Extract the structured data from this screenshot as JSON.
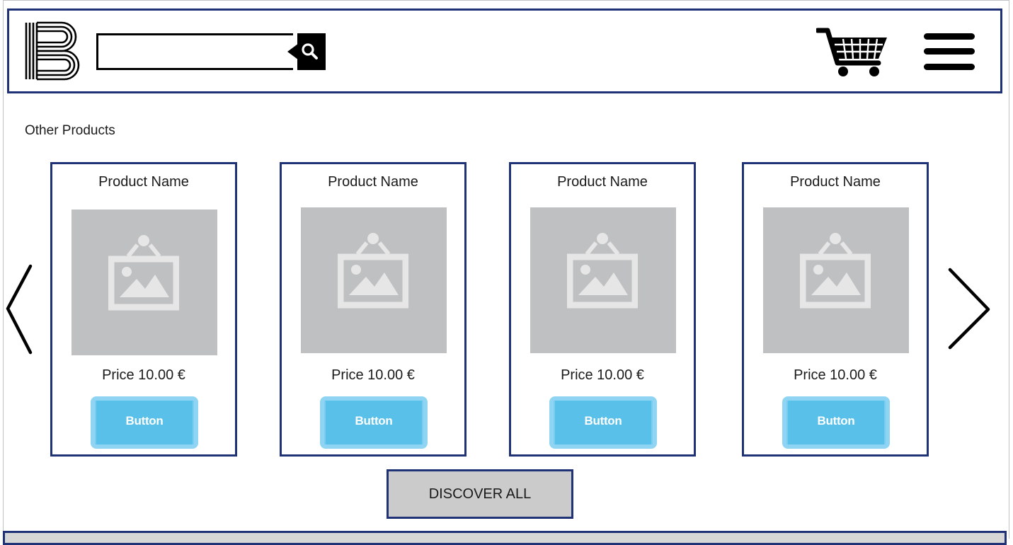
{
  "header": {
    "logo_icon": "brand-b-logo-icon",
    "search": {
      "value": "",
      "placeholder": "",
      "icon": "search-icon"
    },
    "cart_icon": "shopping-cart-icon",
    "menu_icon": "hamburger-menu-icon"
  },
  "section": {
    "title": "Other Products"
  },
  "carousel": {
    "prev_icon": "chevron-left-icon",
    "next_icon": "chevron-right-icon",
    "products": [
      {
        "name": "Product Name",
        "image_icon": "image-placeholder-icon",
        "price": "Price 10.00 €",
        "button": "Button"
      },
      {
        "name": "Product Name",
        "image_icon": "image-placeholder-icon",
        "price": "Price 10.00 €",
        "button": "Button"
      },
      {
        "name": "Product Name",
        "image_icon": "image-placeholder-icon",
        "price": "Price 10.00 €",
        "button": "Button"
      },
      {
        "name": "Product Name",
        "image_icon": "image-placeholder-icon",
        "price": "Price 10.00 €",
        "button": "Button"
      }
    ]
  },
  "discover_all": "DISCOVER ALL",
  "colors": {
    "border": "#1f3275",
    "button_fill": "#59c0ea",
    "button_glow": "#8fd4f2",
    "image_bg": "#bfc0c2",
    "discover_bg": "#cbcbcb"
  }
}
